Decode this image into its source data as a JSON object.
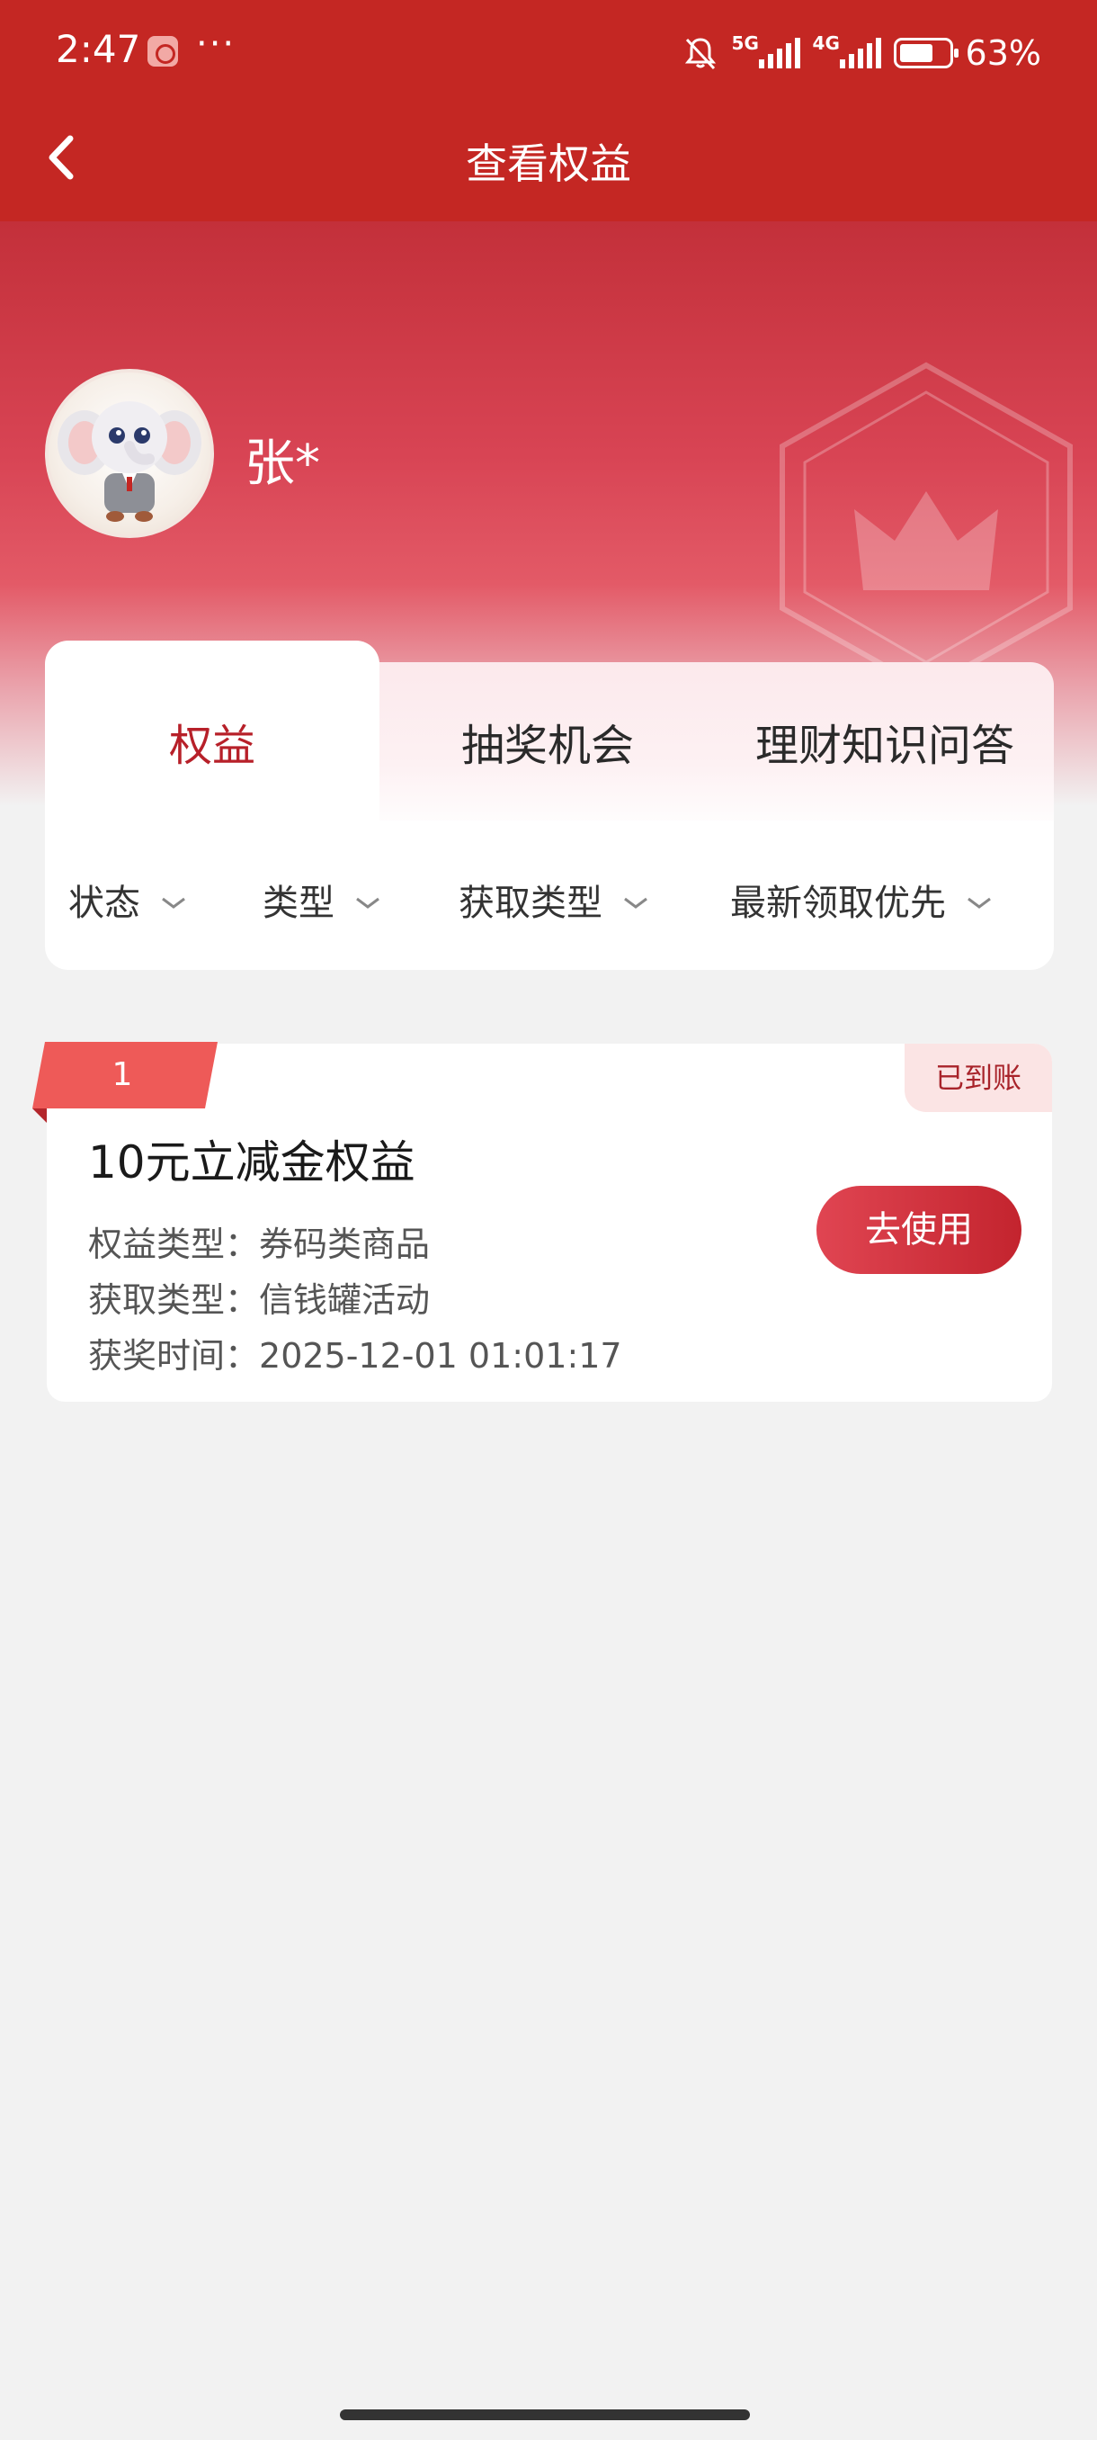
{
  "status_bar": {
    "time": "2:47",
    "more": "···",
    "signal1_label": "5G",
    "signal2_label": "4G",
    "battery_percent": "63%",
    "battery_level": 0.63
  },
  "nav": {
    "title": "查看权益",
    "back_icon": "chevron-left-icon"
  },
  "user": {
    "name": "张*",
    "avatar": "elephant-mascot"
  },
  "tabs": [
    {
      "label": "权益",
      "active": true
    },
    {
      "label": "抽奖机会",
      "active": false
    },
    {
      "label": "理财知识问答",
      "active": false
    }
  ],
  "filters": [
    {
      "label": "状态"
    },
    {
      "label": "类型"
    },
    {
      "label": "获取类型"
    },
    {
      "label": "最新领取优先"
    }
  ],
  "benefit": {
    "index": "1",
    "status": "已到账",
    "title": "10元立减金权益",
    "rows": [
      {
        "key": "权益类型：",
        "value": "券码类商品"
      },
      {
        "key": "获取类型：",
        "value": "信钱罐活动"
      },
      {
        "key": "获奖时间：",
        "value": "2025-12-01 01:01:17"
      }
    ],
    "action": "去使用"
  },
  "colors": {
    "brand_red": "#c42723",
    "accent_red": "#b72029",
    "tag_bg": "#fbe4e4"
  }
}
